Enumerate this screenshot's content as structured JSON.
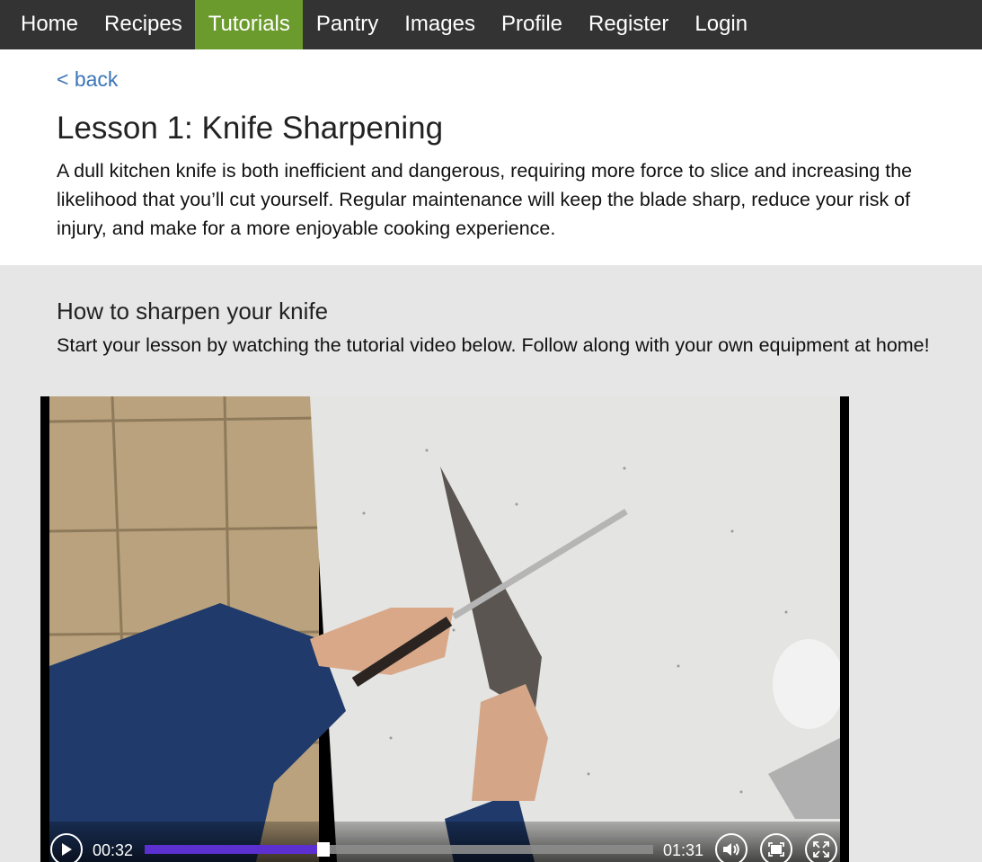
{
  "nav": {
    "items": [
      "Home",
      "Recipes",
      "Tutorials",
      "Pantry",
      "Images",
      "Profile",
      "Register",
      "Login"
    ],
    "active": "Tutorials",
    "active_color": "#6b9b2d",
    "background": "#333333"
  },
  "lesson": {
    "back_label": "< back",
    "title": "Lesson 1: Knife Sharpening",
    "description": "A dull kitchen knife is both inefficient and dangerous, requiring more force to slice and increasing the likelihood that you’ll cut yourself. Regular maintenance will keep the blade sharp, reduce your risk of injury, and make for a more enjoyable cooking experience."
  },
  "section": {
    "title": "How to sharpen your knife",
    "description": "Start your lesson by watching the tutorial video below. Follow along with your own equipment at home!"
  },
  "video": {
    "current_time": "00:32",
    "duration": "01:31",
    "progress_fraction": 0.352,
    "progress_color": "#5b2fd0",
    "icons": [
      "play-icon",
      "volume-icon",
      "fullscreen-window-icon",
      "fullscreen-expand-icon"
    ]
  }
}
